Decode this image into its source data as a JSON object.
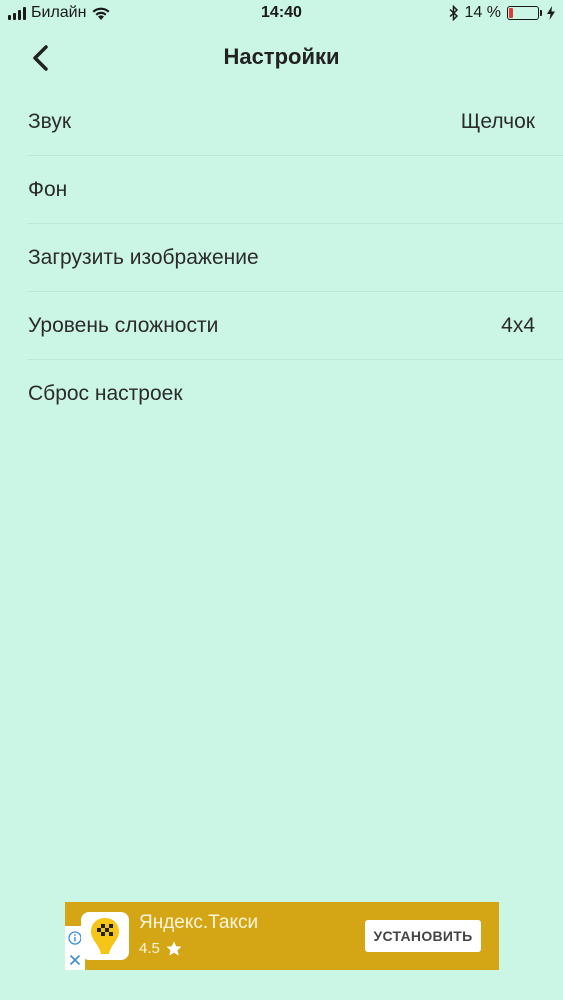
{
  "status_bar": {
    "carrier": "Билайн",
    "time": "14:40",
    "battery_text": "14 %",
    "battery_level": 0.14
  },
  "nav": {
    "title": "Настройки"
  },
  "settings": {
    "items": [
      {
        "label": "Звук",
        "value": "Щелчок"
      },
      {
        "label": "Фон",
        "value": ""
      },
      {
        "label": "Загрузить изображение",
        "value": ""
      },
      {
        "label": "Уровень сложности",
        "value": "4x4"
      },
      {
        "label": "Сброс настроек",
        "value": ""
      }
    ]
  },
  "ad": {
    "app_name": "Яндекс.Такси",
    "rating": "4.5",
    "install_label": "УСТАНОВИТЬ"
  },
  "colors": {
    "background": "#cbf6e6",
    "ad_background": "#d4a514",
    "battery_low": "#e53935"
  },
  "icons": [
    "signal-icon",
    "wifi-icon",
    "bluetooth-icon",
    "battery-icon",
    "charging-icon",
    "back-chevron-icon",
    "taxi-logo-icon",
    "star-icon",
    "info-icon",
    "close-icon"
  ]
}
